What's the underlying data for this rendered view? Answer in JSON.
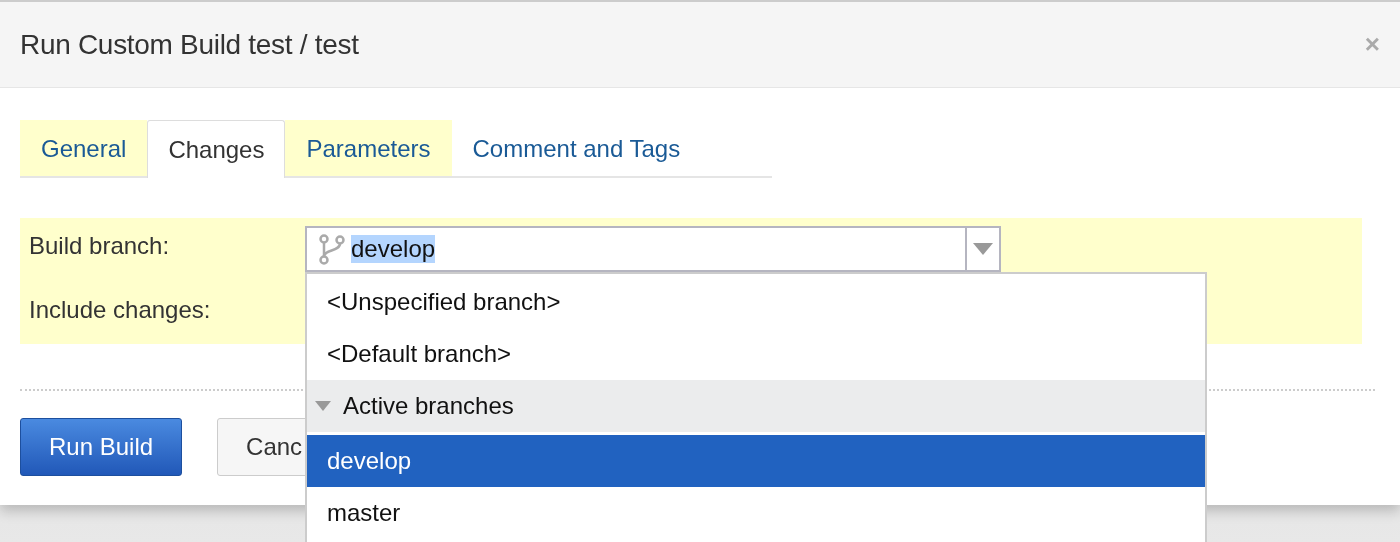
{
  "dialog": {
    "title": "Run Custom Build test / test",
    "close": "×"
  },
  "tabs": [
    {
      "label": "General",
      "selected": false,
      "highlighted": true
    },
    {
      "label": "Changes",
      "selected": true,
      "highlighted": false
    },
    {
      "label": "Parameters",
      "selected": false,
      "highlighted": true
    },
    {
      "label": "Comment and Tags",
      "selected": false,
      "highlighted": false
    }
  ],
  "form": {
    "fields": [
      {
        "label": "Build branch:"
      },
      {
        "label": "Include changes:"
      }
    ],
    "branch_field": {
      "value": "develop"
    }
  },
  "dropdown": {
    "items": [
      {
        "kind": "option",
        "label": "<Unspecified branch>",
        "selected": false
      },
      {
        "kind": "option",
        "label": "<Default branch>",
        "selected": false
      },
      {
        "kind": "group",
        "label": "Active branches",
        "expanded": true
      },
      {
        "kind": "option",
        "label": "develop",
        "selected": true
      },
      {
        "kind": "option",
        "label": "master",
        "selected": false
      }
    ]
  },
  "buttons": [
    {
      "label": "Run Build",
      "kind": "primary"
    },
    {
      "label": "Canc",
      "kind": "secondary"
    }
  ]
}
